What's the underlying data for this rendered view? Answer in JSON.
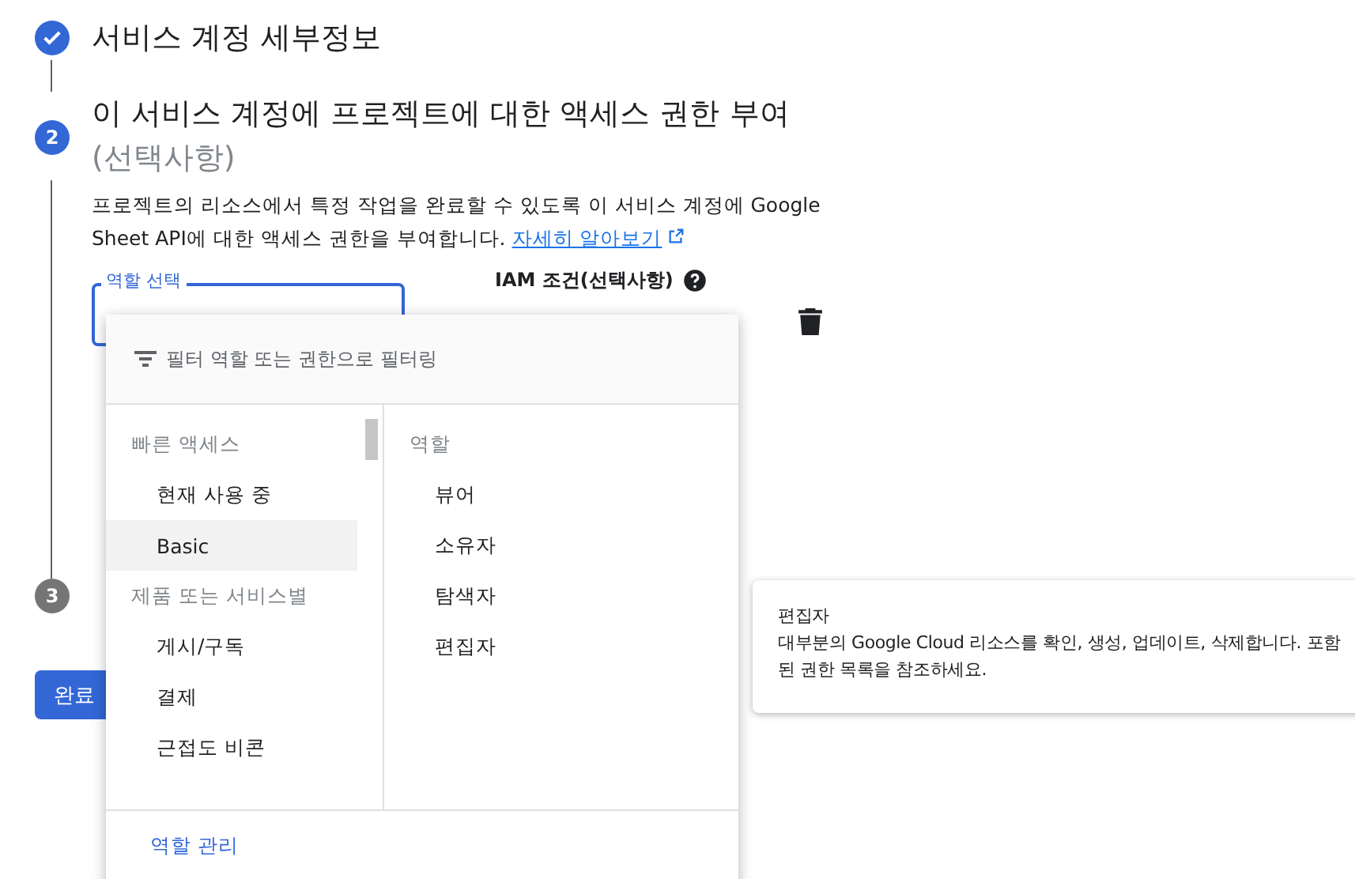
{
  "steps": [
    {
      "completed": true,
      "title": "서비스 계정 세부정보"
    },
    {
      "completed": false,
      "current": true,
      "number": "2",
      "title": "이 서비스 계정에 프로젝트에 대한 액세스 권한 부여",
      "optional": "(선택사항)"
    },
    {
      "completed": false,
      "current": false,
      "number": "3"
    }
  ],
  "description": {
    "text": "프로젝트의 리소스에서 특정 작업을 완료할 수 있도록 이 서비스 계정에 Google Sheet API에 대한 액세스 권한을 부여합니다.",
    "link": "자세히 알아보기"
  },
  "role_field": {
    "label": "역할 선택",
    "focused": true
  },
  "iam_condition": {
    "label": "IAM 조건(선택사항)"
  },
  "done_button": "완료",
  "dropdown": {
    "filter": {
      "prefix": "필터",
      "placeholder": "역할 또는 권한으로 필터링"
    },
    "categories": [
      {
        "kind": "header",
        "label": "빠른 액세스"
      },
      {
        "kind": "item",
        "label": "현재 사용 중",
        "selected": false
      },
      {
        "kind": "item",
        "label": "Basic",
        "selected": true
      },
      {
        "kind": "header",
        "label": "제품 또는 서비스별"
      },
      {
        "kind": "item",
        "label": "게시/구독",
        "selected": false
      },
      {
        "kind": "item",
        "label": "결제",
        "selected": false
      },
      {
        "kind": "item",
        "label": "근접도 비콘",
        "selected": false
      }
    ],
    "roles_header": "역할",
    "roles": [
      "뷰어",
      "소유자",
      "탐색자",
      "편집자"
    ],
    "manage_link": "역할 관리"
  },
  "tooltip": {
    "title": "편집자",
    "body": "대부분의 Google Cloud 리소스를 확인, 생성, 업데이트, 삭제합니다. 포함된 권한 목록을 참조하세요."
  }
}
